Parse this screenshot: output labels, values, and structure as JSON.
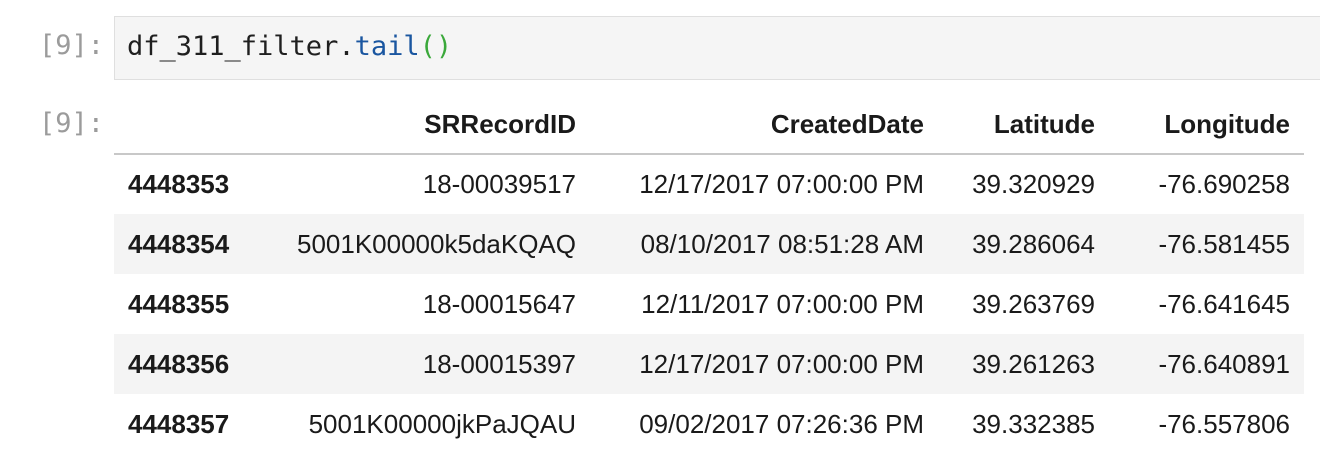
{
  "input_cell": {
    "prompt": "[9]:",
    "code_object": "df_311_filter.",
    "code_method": "tail",
    "code_parens": "()"
  },
  "output_cell": {
    "prompt": "[9]:",
    "columns": [
      "",
      "SRRecordID",
      "CreatedDate",
      "Latitude",
      "Longitude"
    ],
    "rows": [
      {
        "index": "4448353",
        "SRRecordID": "18-00039517",
        "CreatedDate": "12/17/2017 07:00:00 PM",
        "Latitude": "39.320929",
        "Longitude": "-76.690258"
      },
      {
        "index": "4448354",
        "SRRecordID": "5001K00000k5daKQAQ",
        "CreatedDate": "08/10/2017 08:51:28 AM",
        "Latitude": "39.286064",
        "Longitude": "-76.581455"
      },
      {
        "index": "4448355",
        "SRRecordID": "18-00015647",
        "CreatedDate": "12/11/2017 07:00:00 PM",
        "Latitude": "39.263769",
        "Longitude": "-76.641645"
      },
      {
        "index": "4448356",
        "SRRecordID": "18-00015397",
        "CreatedDate": "12/17/2017 07:00:00 PM",
        "Latitude": "39.261263",
        "Longitude": "-76.640891"
      },
      {
        "index": "4448357",
        "SRRecordID": "5001K00000jkPaJQAU",
        "CreatedDate": "09/02/2017 07:26:36 PM",
        "Latitude": "39.332385",
        "Longitude": "-76.557806"
      }
    ]
  }
}
